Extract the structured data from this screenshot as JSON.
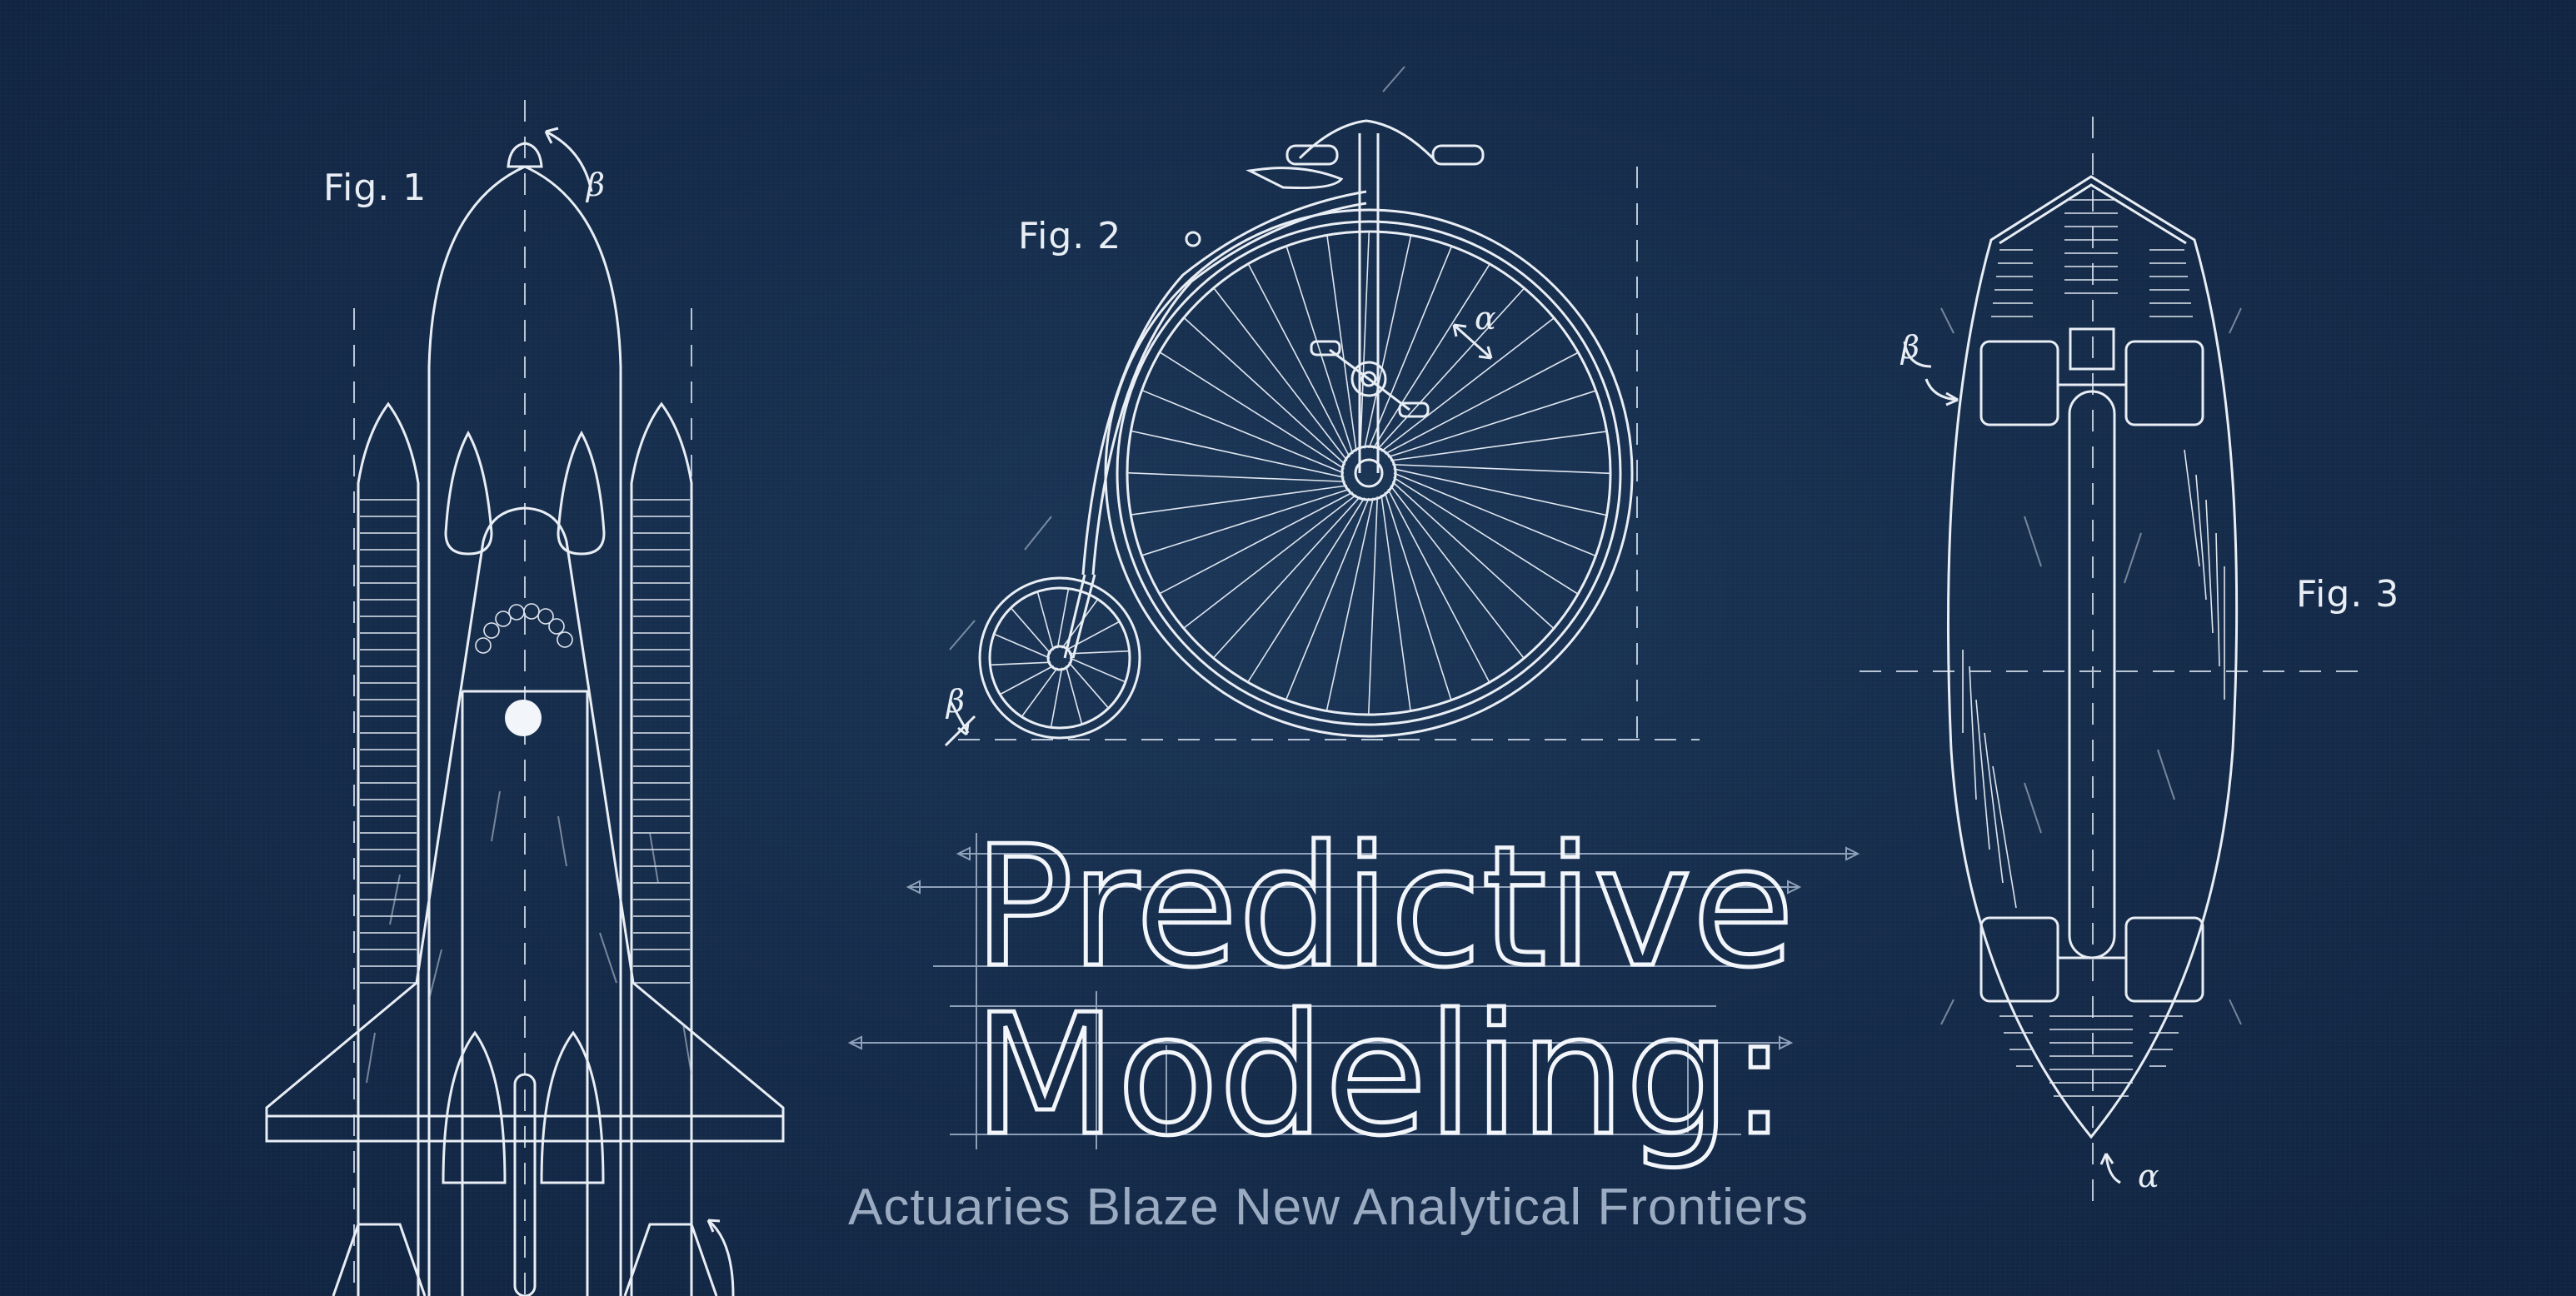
{
  "figures": {
    "fig1": "Fig. 1",
    "fig2": "Fig. 2",
    "fig3": "Fig. 3"
  },
  "annotations": {
    "beta": "β",
    "alpha": "α"
  },
  "title": {
    "line1": "Predictive",
    "line2": "Modeling:",
    "subtitle": "Actuaries Blaze New Analytical Frontiers"
  },
  "icons": [
    "space-shuttle-icon",
    "penny-farthing-bicycle-icon",
    "skateboard-icon"
  ],
  "colors": {
    "background": "#142a47",
    "lines": "#e9eef5",
    "subtitle": "#9aaac0"
  }
}
